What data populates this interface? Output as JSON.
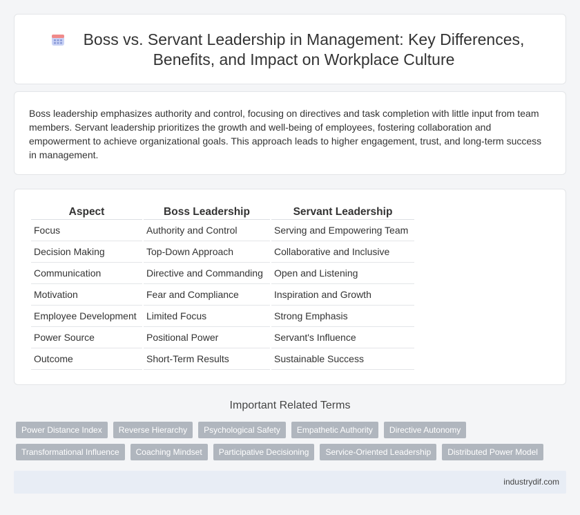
{
  "header": {
    "title": "Boss vs. Servant Leadership in Management: Key Differences, Benefits, and Impact on Workplace Culture",
    "icon": "calendar-icon"
  },
  "intro": {
    "text": "Boss leadership emphasizes authority and control, focusing on directives and task completion with little input from team members. Servant leadership prioritizes the growth and well-being of employees, fostering collaboration and empowerment to achieve organizational goals. This approach leads to higher engagement, trust, and long-term success in management."
  },
  "table": {
    "headers": [
      "Aspect",
      "Boss Leadership",
      "Servant Leadership"
    ],
    "rows": [
      [
        "Focus",
        "Authority and Control",
        "Serving and Empowering Team"
      ],
      [
        "Decision Making",
        "Top-Down Approach",
        "Collaborative and Inclusive"
      ],
      [
        "Communication",
        "Directive and Commanding",
        "Open and Listening"
      ],
      [
        "Motivation",
        "Fear and Compliance",
        "Inspiration and Growth"
      ],
      [
        "Employee Development",
        "Limited Focus",
        "Strong Emphasis"
      ],
      [
        "Power Source",
        "Positional Power",
        "Servant's Influence"
      ],
      [
        "Outcome",
        "Short-Term Results",
        "Sustainable Success"
      ]
    ]
  },
  "related": {
    "title": "Important Related Terms",
    "row1": [
      "Power Distance Index",
      "Reverse Hierarchy",
      "Psychological Safety",
      "Empathetic Authority",
      "Directive Autonomy"
    ],
    "row2": [
      "Transformational Influence",
      "Coaching Mindset",
      "Participative Decisioning",
      "Service-Oriented Leadership",
      "Distributed Power Model"
    ]
  },
  "footer": {
    "site": "industrydif.com"
  },
  "colors": {
    "tag_bg": "#b0b6be",
    "footer_bg": "#e8edf5",
    "icon_accent": "#8a9bd8"
  }
}
